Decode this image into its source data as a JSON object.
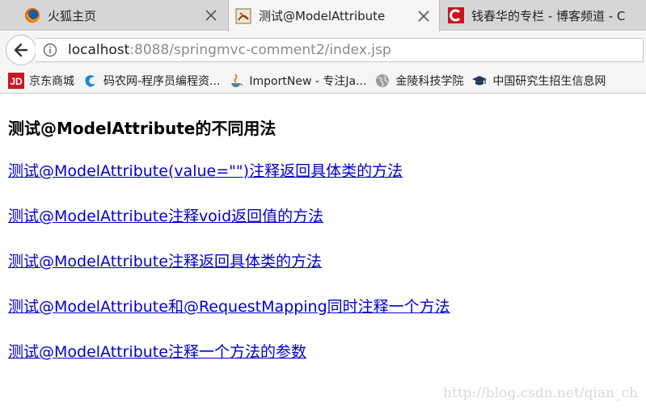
{
  "tabs": [
    {
      "title": "火狐主页",
      "icon": "firefox-icon",
      "active": false
    },
    {
      "title": "测试@ModelAttribute",
      "icon": "java-icon",
      "active": true
    },
    {
      "title": "钱春华的专栏 - 博客频道 - C",
      "icon": "csdn-icon",
      "active": false
    }
  ],
  "address": {
    "host": "localhost",
    "rest": ":8088/springmvc-comment2/index.jsp"
  },
  "bookmarks": [
    {
      "label": "京东商城",
      "icon": "jd-icon"
    },
    {
      "label": "码农网-程序员编程资...",
      "icon": "codeceo-icon"
    },
    {
      "label": "ImportNew - 专注Ja...",
      "icon": "java-icon"
    },
    {
      "label": "金陵科技学院",
      "icon": "globe-icon"
    },
    {
      "label": "中国研究生招生信息网",
      "icon": "graduation-cap-icon"
    }
  ],
  "page": {
    "heading": "测试@ModelAttribute的不同用法",
    "links": [
      "测试@ModelAttribute(value=\"\")注释返回具体类的方法",
      "测试@ModelAttribute注释void返回值的方法",
      "测试@ModelAttribute注释返回具体类的方法",
      "测试@ModelAttribute和@RequestMapping同时注释一个方法",
      "测试@ModelAttribute注释一个方法的参数"
    ],
    "watermark": "http://blog.csdn.net/qian_ch"
  },
  "colors": {
    "link": "#0000cc",
    "tab_strip": "#d6d6d6",
    "toolbar": "#f5f5f5"
  }
}
